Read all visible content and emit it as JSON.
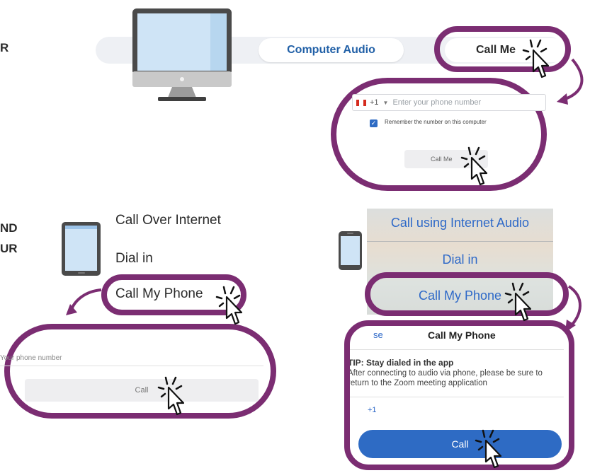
{
  "side_text": {
    "line1": "R",
    "line2": "ND",
    "line3": "UR"
  },
  "desktop": {
    "tab_computer_audio": "Computer Audio",
    "tab_call_me": "Call Me",
    "country_code": "+1",
    "phone_placeholder": "Enter your phone number",
    "remember_label": "Remember the number on this computer",
    "call_me_button": "Call Me"
  },
  "tablet": {
    "menu_items": [
      "Call Over Internet",
      "Dial in",
      "Call My Phone"
    ],
    "phone_placeholder": "Your phone number",
    "call_button": "Call"
  },
  "iphone": {
    "rows": [
      "Call using Internet Audio",
      "Dial in",
      "Call My Phone"
    ],
    "close_label": "se",
    "dialog_title": "Call My Phone",
    "tip_title": "TIP: Stay dialed in the app",
    "tip_body": "After connecting to audio via phone, please be sure to return to the Zoom meeting application",
    "country_code": "+1",
    "call_button": "Call"
  },
  "colors": {
    "accent_ring": "#7b2d72",
    "zoom_blue": "#2e6bc4",
    "tab_blue": "#2160a7"
  }
}
